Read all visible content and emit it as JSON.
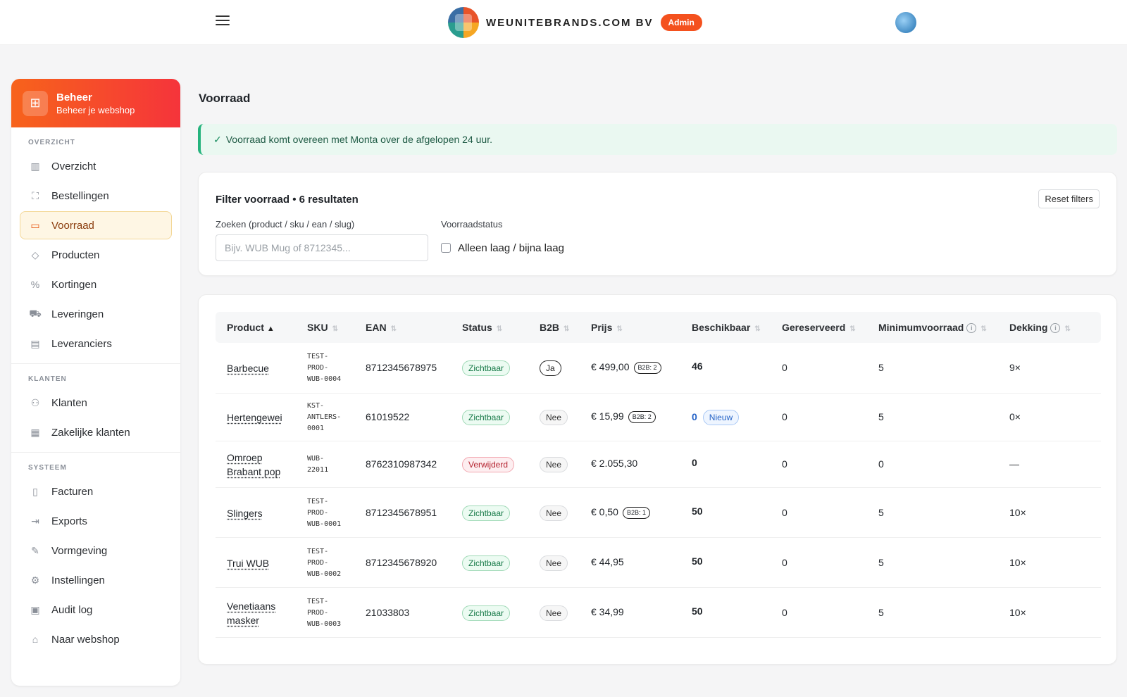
{
  "header": {
    "brand_name": "WEUNITEBRANDS.COM BV",
    "badge": "Admin"
  },
  "sidebar": {
    "title": "Beheer",
    "subtitle": "Beheer je webshop",
    "sections": [
      {
        "label": "OVERZICHT",
        "items": [
          {
            "label": "Overzicht",
            "icon": "chart-icon"
          },
          {
            "label": "Bestellingen",
            "icon": "bag-icon"
          },
          {
            "label": "Voorraad",
            "icon": "box-icon",
            "active": true
          },
          {
            "label": "Producten",
            "icon": "tag-icon"
          },
          {
            "label": "Kortingen",
            "icon": "discount-icon"
          },
          {
            "label": "Leveringen",
            "icon": "truck-icon"
          },
          {
            "label": "Leveranciers",
            "icon": "id-card-icon"
          }
        ]
      },
      {
        "label": "KLANTEN",
        "items": [
          {
            "label": "Klanten",
            "icon": "users-icon"
          },
          {
            "label": "Zakelijke klanten",
            "icon": "building-icon"
          }
        ]
      },
      {
        "label": "SYSTEEM",
        "items": [
          {
            "label": "Facturen",
            "icon": "document-icon"
          },
          {
            "label": "Exports",
            "icon": "export-icon"
          },
          {
            "label": "Vormgeving",
            "icon": "brush-icon"
          },
          {
            "label": "Instellingen",
            "icon": "gear-icon"
          },
          {
            "label": "Audit log",
            "icon": "clipboard-icon"
          },
          {
            "label": "Naar webshop",
            "icon": "home-icon"
          }
        ]
      }
    ]
  },
  "page": {
    "title": "Voorraad",
    "alert": "Voorraad komt overeen met Monta over de afgelopen 24 uur."
  },
  "filter": {
    "title": "Filter voorraad • 6 resultaten",
    "reset_label": "Reset filters",
    "search_label": "Zoeken (product / sku / ean / slug)",
    "search_placeholder": "Bijv. WUB Mug of 8712345...",
    "search_value": "",
    "status_label": "Voorraadstatus",
    "checkbox_label": "Alleen laag / bijna laag",
    "checkbox_checked": false
  },
  "table": {
    "columns": [
      "Product",
      "SKU",
      "EAN",
      "Status",
      "B2B",
      "Prijs",
      "Beschikbaar",
      "Gereserveerd",
      "Minimumvoorraad",
      "Dekking"
    ],
    "rows": [
      {
        "product": [
          "Barbecue"
        ],
        "sku": [
          "TEST-",
          "PROD-",
          "WUB-0004"
        ],
        "ean": "8712345678975",
        "status": "Zichtbaar",
        "status_type": "green",
        "b2b": "Ja",
        "price": "€ 499,00",
        "b2b_qty": "B2B: 2",
        "available": "46",
        "available_new": "",
        "reserved": "0",
        "minimum": "5",
        "coverage": "9×"
      },
      {
        "product": [
          "Hertengewei"
        ],
        "sku": [
          "KST-",
          "ANTLERS-",
          "0001"
        ],
        "ean": "61019522",
        "status": "Zichtbaar",
        "status_type": "green",
        "b2b": "Nee",
        "price": "€ 15,99",
        "b2b_qty": "B2B: 2",
        "available": "0",
        "available_new": "Nieuw",
        "reserved": "0",
        "minimum": "5",
        "coverage": "0×"
      },
      {
        "product": [
          "Omroep",
          "Brabant pop"
        ],
        "sku": [
          "WUB-",
          "22011"
        ],
        "ean": "8762310987342",
        "status": "Verwijderd",
        "status_type": "red",
        "b2b": "Nee",
        "price": "€ 2.055,30",
        "b2b_qty": "",
        "available": "0",
        "available_new": "",
        "reserved": "0",
        "minimum": "0",
        "coverage": "—"
      },
      {
        "product": [
          "Slingers"
        ],
        "sku": [
          "TEST-",
          "PROD-",
          "WUB-0001"
        ],
        "ean": "8712345678951",
        "status": "Zichtbaar",
        "status_type": "green",
        "b2b": "Nee",
        "price": "€ 0,50",
        "b2b_qty": "B2B: 1",
        "available": "50",
        "available_new": "",
        "reserved": "0",
        "minimum": "5",
        "coverage": "10×"
      },
      {
        "product": [
          "Trui WUB"
        ],
        "sku": [
          "TEST-",
          "PROD-",
          "WUB-0002"
        ],
        "ean": "8712345678920",
        "status": "Zichtbaar",
        "status_type": "green",
        "b2b": "Nee",
        "price": "€ 44,95",
        "b2b_qty": "",
        "available": "50",
        "available_new": "",
        "reserved": "0",
        "minimum": "5",
        "coverage": "10×"
      },
      {
        "product": [
          "Venetiaans",
          "masker"
        ],
        "sku": [
          "TEST-",
          "PROD-",
          "WUB-0003"
        ],
        "ean": "21033803",
        "status": "Zichtbaar",
        "status_type": "green",
        "b2b": "Nee",
        "price": "€ 34,99",
        "b2b_qty": "",
        "available": "50",
        "available_new": "",
        "reserved": "0",
        "minimum": "5",
        "coverage": "10×"
      }
    ]
  },
  "colors": {
    "accent_orange": "#f7631b",
    "accent_red": "#f5343b",
    "success_green": "#25b37d"
  }
}
